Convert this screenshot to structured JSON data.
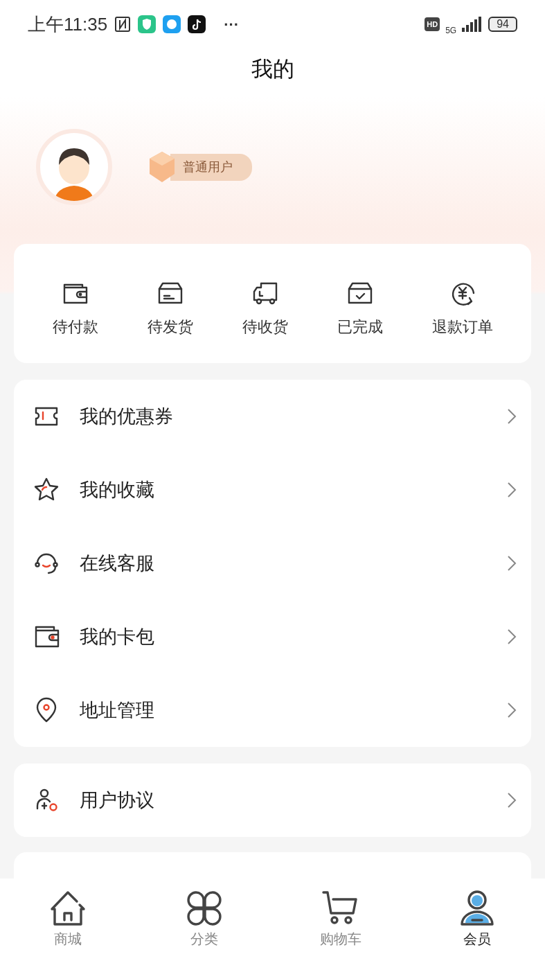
{
  "status_bar": {
    "time": "上午11:35",
    "more": "···",
    "network": "5G",
    "battery": "94",
    "hd": "HD"
  },
  "page_title": "我的",
  "profile": {
    "level_badge": "普通用户"
  },
  "orders": [
    {
      "kind": "wallet",
      "label": "待付款"
    },
    {
      "kind": "box",
      "label": "待发货"
    },
    {
      "kind": "truck",
      "label": "待收货"
    },
    {
      "kind": "done",
      "label": "已完成"
    },
    {
      "kind": "refund",
      "label": "退款订单"
    }
  ],
  "menu": [
    {
      "kind": "coupon",
      "label": "我的优惠券"
    },
    {
      "kind": "star",
      "label": "我的收藏"
    },
    {
      "kind": "headset",
      "label": "在线客服"
    },
    {
      "kind": "wallet",
      "label": "我的卡包"
    },
    {
      "kind": "location",
      "label": "地址管理"
    }
  ],
  "menu2": [
    {
      "kind": "agreement",
      "label": "用户协议"
    }
  ],
  "tabs": [
    {
      "kind": "home",
      "label": "商城",
      "selected": false
    },
    {
      "kind": "grid",
      "label": "分类",
      "selected": false
    },
    {
      "kind": "cart",
      "label": "购物车",
      "selected": false
    },
    {
      "kind": "user",
      "label": "会员",
      "selected": true
    }
  ]
}
